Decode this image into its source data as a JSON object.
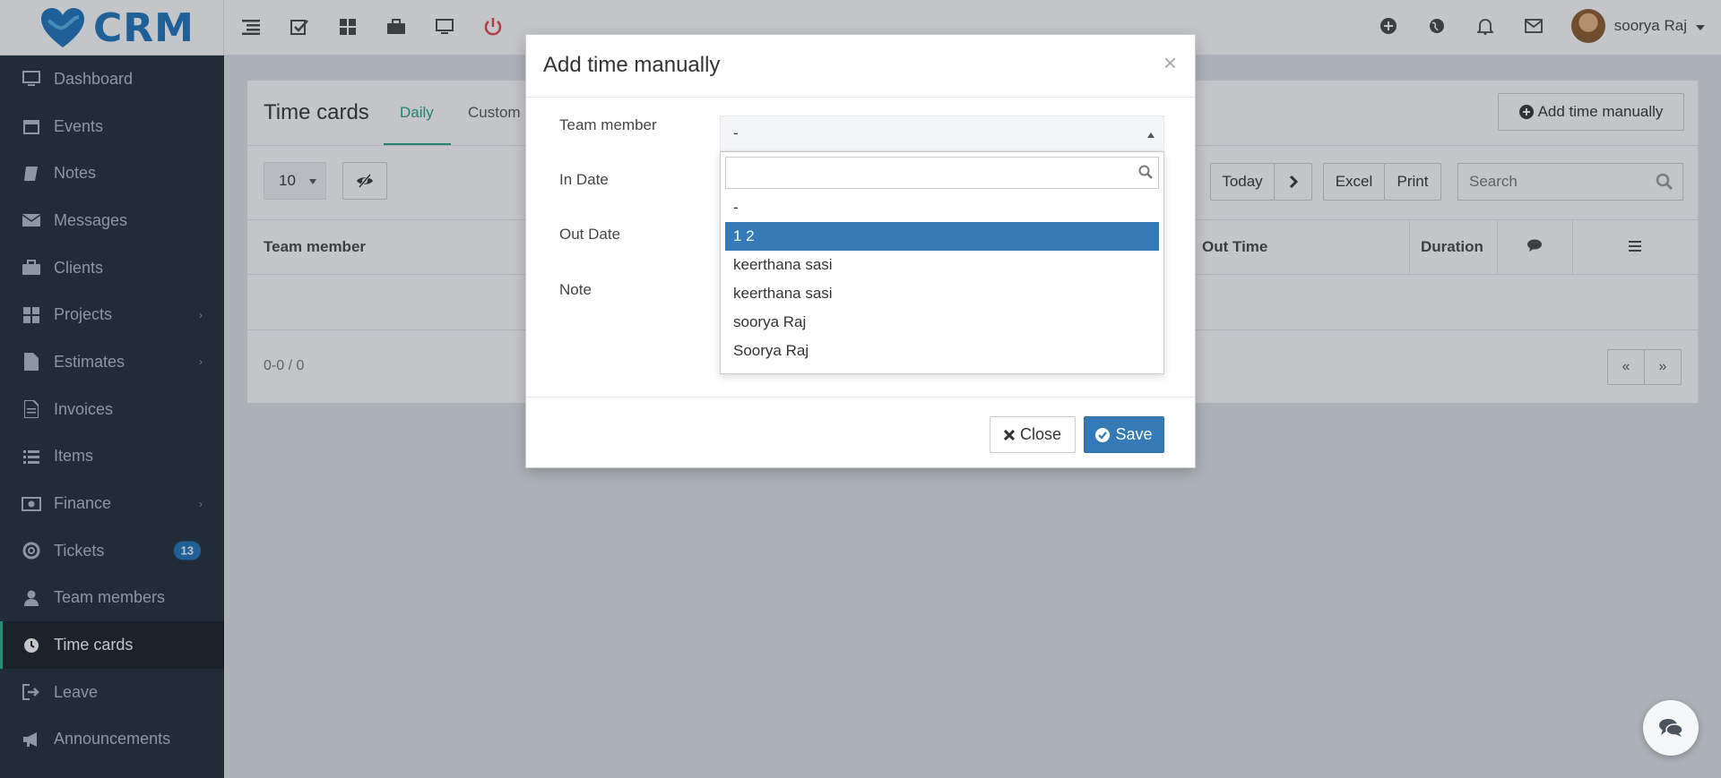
{
  "brand": {
    "name": "CRM"
  },
  "topbar": {
    "left_icons": [
      "list-icon",
      "checkbox-icon",
      "grid-icon",
      "briefcase-icon",
      "monitor-icon",
      "power-icon"
    ],
    "right_icons": [
      "plus-circle-icon",
      "globe-icon",
      "bell-icon",
      "mail-icon"
    ],
    "user_name": "soorya Raj"
  },
  "sidebar": {
    "items": [
      {
        "label": "Dashboard",
        "icon": "monitor-icon"
      },
      {
        "label": "Events",
        "icon": "calendar-icon"
      },
      {
        "label": "Notes",
        "icon": "book-icon"
      },
      {
        "label": "Messages",
        "icon": "envelope-icon"
      },
      {
        "label": "Clients",
        "icon": "briefcase-icon"
      },
      {
        "label": "Projects",
        "icon": "grid-icon",
        "has_submenu": true
      },
      {
        "label": "Estimates",
        "icon": "file-icon",
        "has_submenu": true
      },
      {
        "label": "Invoices",
        "icon": "file-text-icon"
      },
      {
        "label": "Items",
        "icon": "list-icon"
      },
      {
        "label": "Finance",
        "icon": "money-icon",
        "has_submenu": true
      },
      {
        "label": "Tickets",
        "icon": "lifebuoy-icon",
        "badge": "13"
      },
      {
        "label": "Team members",
        "icon": "user-icon"
      },
      {
        "label": "Time cards",
        "icon": "clock-icon",
        "active": true
      },
      {
        "label": "Leave",
        "icon": "sign-out-icon"
      },
      {
        "label": "Announcements",
        "icon": "bullhorn-icon"
      }
    ]
  },
  "page": {
    "title": "Time cards",
    "tabs": [
      "Daily",
      "Custom"
    ],
    "active_tab": "Daily",
    "add_button": "Add time manually",
    "page_size": "10",
    "today_button": "Today",
    "excel_button": "Excel",
    "print_button": "Print",
    "search_placeholder": "Search",
    "columns": [
      "Team member",
      "Out Time",
      "Duration"
    ],
    "pager_info": "0-0 / 0",
    "accent_color": "#22a37c"
  },
  "modal": {
    "title": "Add time manually",
    "labels": {
      "team_member": "Team member",
      "in_date": "In Date",
      "out_date": "Out Date",
      "note": "Note"
    },
    "team_member_value": "-",
    "dropdown_options": [
      "-",
      "1 2",
      "keerthana sasi",
      "keerthana sasi",
      "soorya Raj",
      "Soorya Raj"
    ],
    "highlighted_option": "1 2",
    "close_button": "Close",
    "save_button": "Save"
  }
}
